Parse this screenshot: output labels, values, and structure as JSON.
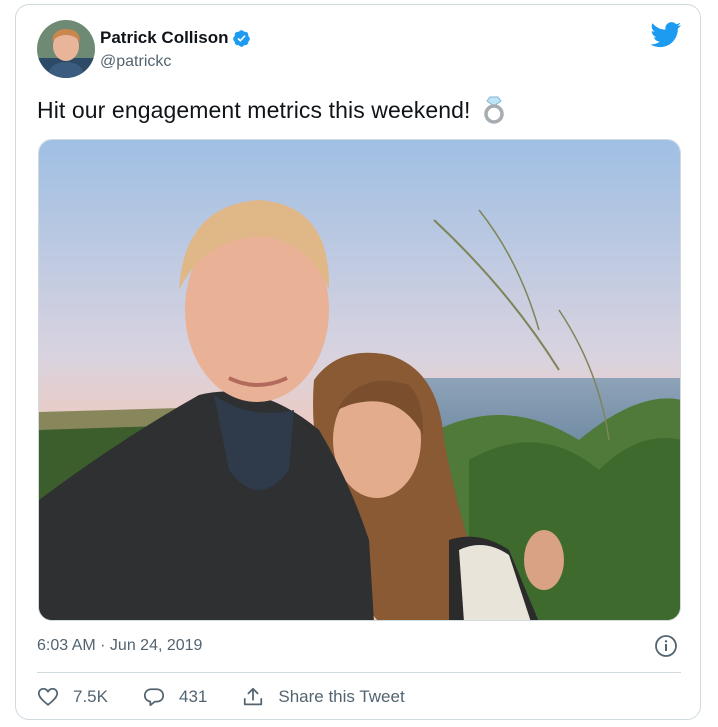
{
  "author": {
    "name": "Patrick Collison",
    "handle": "@patrickc",
    "verified_icon": "verified-badge-icon",
    "avatar_icon": "avatar"
  },
  "brand": {
    "icon": "twitter-bird-icon",
    "color": "#1d9bf0"
  },
  "tweet": {
    "text": "Hit our engagement metrics this weekend!",
    "emoji_icon": "ring-icon",
    "photo": "photo"
  },
  "meta": {
    "timestamp": "6:03 AM · Jun 24, 2019",
    "info_icon": "info-icon"
  },
  "actions": {
    "likes": "7.5K",
    "replies": "431",
    "share_label": "Share this Tweet"
  },
  "colors": {
    "text_primary": "#0f1419",
    "text_secondary": "#536471",
    "border": "#cfd9de",
    "verified": "#1d9bf0"
  }
}
